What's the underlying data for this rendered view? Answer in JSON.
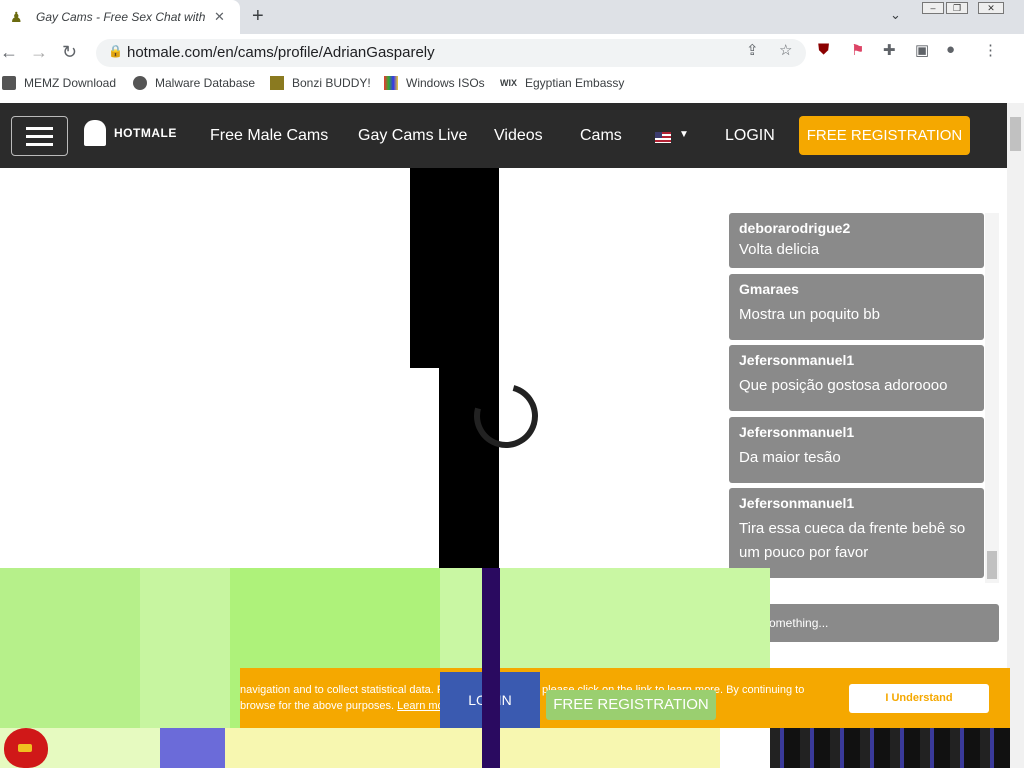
{
  "browser": {
    "tab_title": "Gay Cams - Free Sex Chat with S",
    "url": "hotmale.com/en/cams/profile/AdrianGasparely",
    "bookmarks": [
      {
        "label": "MEMZ Download",
        "icon": "windows-icon"
      },
      {
        "label": "Malware Database",
        "icon": "globe-icon"
      },
      {
        "label": "Bonzi BUDDY!",
        "icon": "bonzi-icon"
      },
      {
        "label": "Windows ISOs",
        "icon": "windows-flag-icon"
      },
      {
        "label": "Egyptian Embassy",
        "icon": "wix-icon"
      }
    ],
    "wix_label": "WIX"
  },
  "site": {
    "logo_text": "HOTMALE",
    "nav": [
      "Free Male Cams",
      "Gay Cams Live",
      "Videos",
      "Cams"
    ],
    "login": "LOGIN",
    "register": "FREE REGISTRATION"
  },
  "chat": {
    "messages": [
      {
        "user": "deborarodrigue2",
        "text": "Volta delicia"
      },
      {
        "user": "Gmaraes",
        "text": "Mostra un poquito bb"
      },
      {
        "user": "Jefersonmanuel1",
        "text": "Que posição gostosa adoroooo"
      },
      {
        "user": "Jefersonmanuel1",
        "text": "Da maior tesão"
      },
      {
        "user": "Jefersonmanuel1",
        "text": "Tira essa cueca da frente bebê so um pouco por favor"
      }
    ],
    "input_placeholder": "Say something..."
  },
  "cookie": {
    "text_part1": "navigation and to collect statistical data. For more information please click on the link to learn more. By continuing to browse",
    "text_part2": "for the above purposes.",
    "learn_more": "Learn more",
    "button": "I Understand"
  }
}
